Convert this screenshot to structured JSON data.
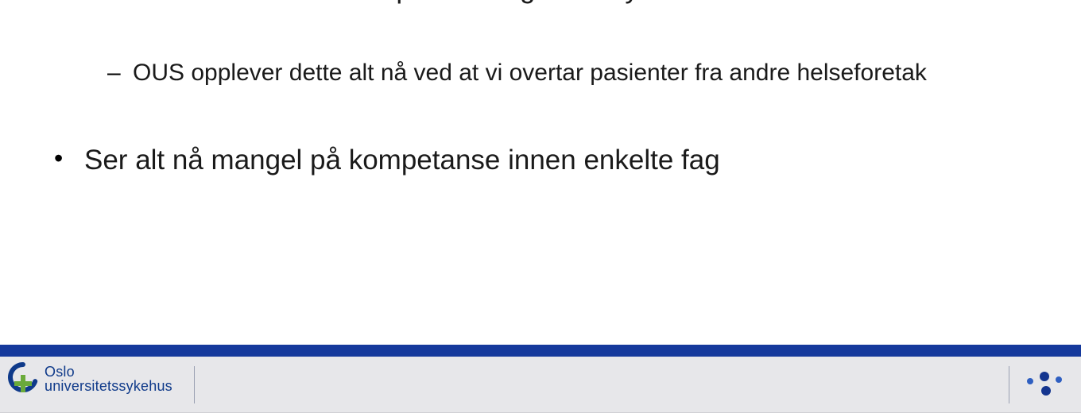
{
  "content": {
    "bullet1_partial": "en sentraliserende effekt på utviklingen av sykehusstrukturen",
    "sub1": "OUS opplever dette alt nå ved at vi overtar pasienter fra andre helseforetak",
    "bullet2": "Ser alt nå mangel på kompetanse innen enkelte fag"
  },
  "footer": {
    "logo_line1": "Oslo",
    "logo_line2": "universitetssykehus"
  }
}
